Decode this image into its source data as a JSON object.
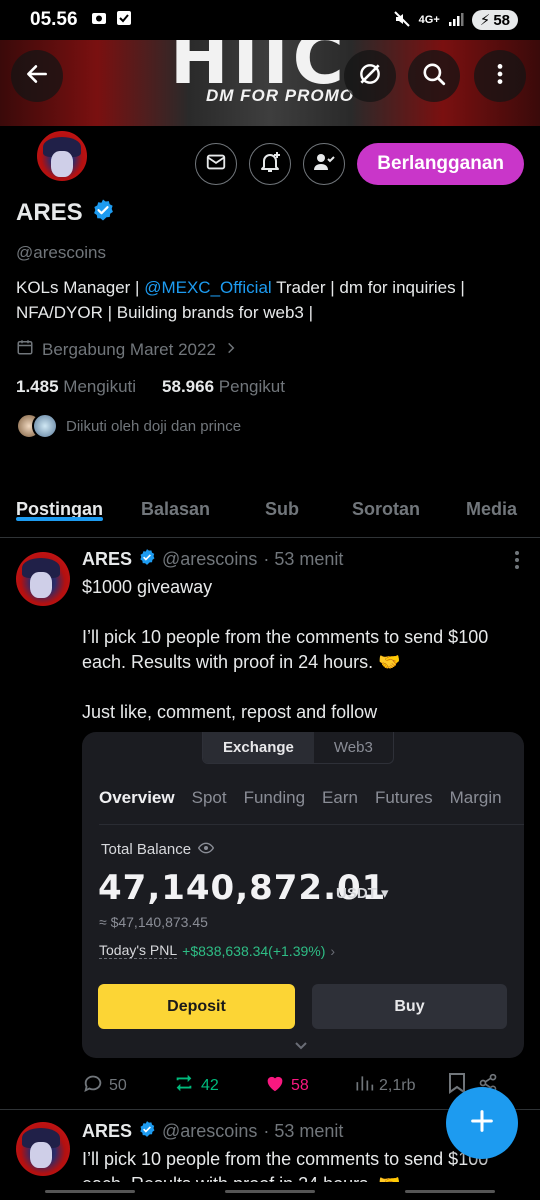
{
  "status_bar": {
    "time": "05.56",
    "network": "4G+",
    "battery": "58"
  },
  "banner": {
    "big_text": "HIIC",
    "promo_text": "DM FOR PROMO"
  },
  "header_actions": {
    "subscribe_label": "Berlangganan"
  },
  "profile": {
    "display_name": "ARES",
    "handle": "@arescoins",
    "bio_prefix": "KOLs Manager | ",
    "bio_mention": "@MEXC_Official",
    "bio_suffix": " Trader | dm for inquiries | NFA/DYOR | Building brands for web3 |",
    "joined": "Bergabung Maret 2022",
    "following_count": "1.485",
    "following_label": "Mengikuti",
    "followers_count": "58.966",
    "followers_label": "Pengikut",
    "followed_by": "Diikuti oleh doji dan prince"
  },
  "tabs": [
    {
      "label": "Postingan",
      "active": true
    },
    {
      "label": "Balasan",
      "active": false
    },
    {
      "label": "Sub",
      "active": false
    },
    {
      "label": "Sorotan",
      "active": false
    },
    {
      "label": "Media",
      "active": false
    }
  ],
  "posts": [
    {
      "name": "ARES",
      "handle": "@arescoins",
      "time": "· 53 menit",
      "text": "$1000 giveaway\n\nI’ll pick 10 people from the comments to send $100 each. Results with proof in 24 hours. 🤝\n\nJust like, comment, repost and follow",
      "media": {
        "segment": [
          "Exchange",
          "Web3"
        ],
        "tabs": [
          "Overview",
          "Spot",
          "Funding",
          "Earn",
          "Futures",
          "Margin"
        ],
        "total_balance_label": "Total Balance",
        "balance": "47,140,872.01",
        "currency": "USDT ▾",
        "approx": "≈ $47,140,873.45",
        "pnl_label": "Today's PNL",
        "pnl_value": "+$838,638.34(+1.39%)",
        "deposit_label": "Deposit",
        "buy_label": "Buy"
      },
      "replies": "50",
      "reposts": "42",
      "likes": "58",
      "views": "2,1rb"
    },
    {
      "name": "ARES",
      "handle": "@arescoins",
      "time": "· 53 menit",
      "text": "I’ll pick 10 people from the comments to send $100 each. Results with proof in 24 hours. 🤝"
    }
  ],
  "colors": {
    "accent": "#1d9bf0",
    "subscribe": "#c936c9",
    "like": "#f91880",
    "repost": "#00ba7c",
    "deposit": "#fcd535",
    "pnl_positive": "#2ebd85"
  }
}
